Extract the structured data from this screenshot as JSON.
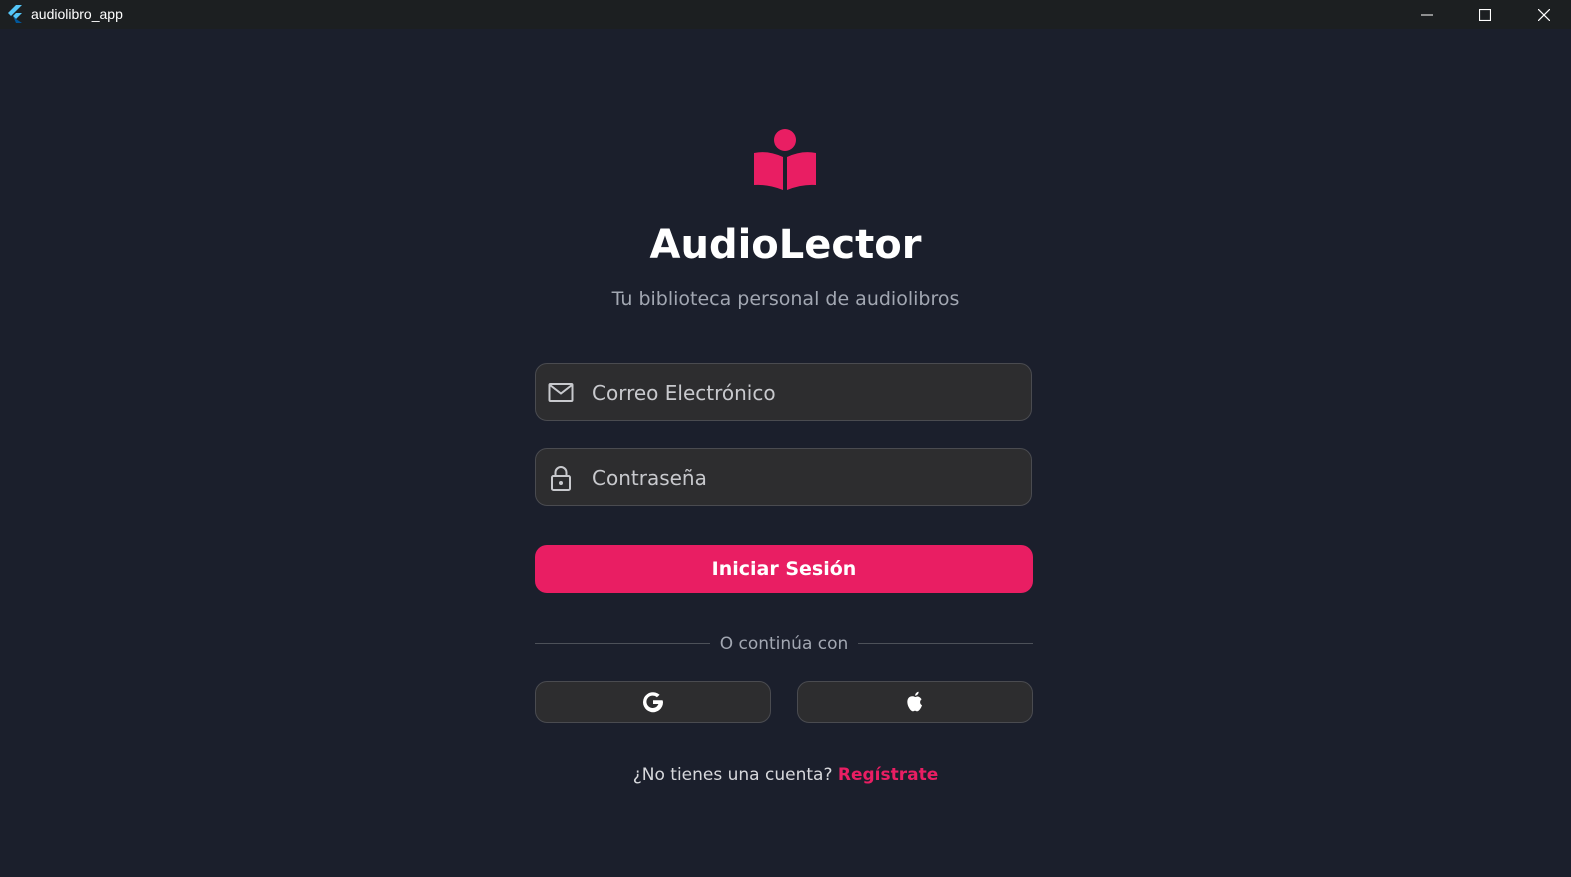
{
  "window": {
    "title": "audiolibro_app",
    "icon": "flutter-icon"
  },
  "app": {
    "name": "AudioLector",
    "tagline": "Tu biblioteca personal de audiolibros",
    "logo_icon": "reading-book-icon"
  },
  "form": {
    "email": {
      "placeholder": "Correo Electrónico",
      "value": "",
      "icon": "mail-icon"
    },
    "password": {
      "placeholder": "Contraseña",
      "value": "",
      "icon": "lock-icon"
    },
    "login_label": "Iniciar Sesión",
    "divider_text": "O continúa con",
    "social": [
      {
        "name": "google",
        "icon": "google-icon"
      },
      {
        "name": "apple",
        "icon": "apple-icon"
      }
    ],
    "signup_prompt": "¿No tienes una cuenta?",
    "signup_link": "Regístrate"
  },
  "colors": {
    "background": "#1b1f2c",
    "accent": "#e91e63",
    "field_background": "#2d2d2f",
    "muted_text": "#a2a7b2"
  }
}
